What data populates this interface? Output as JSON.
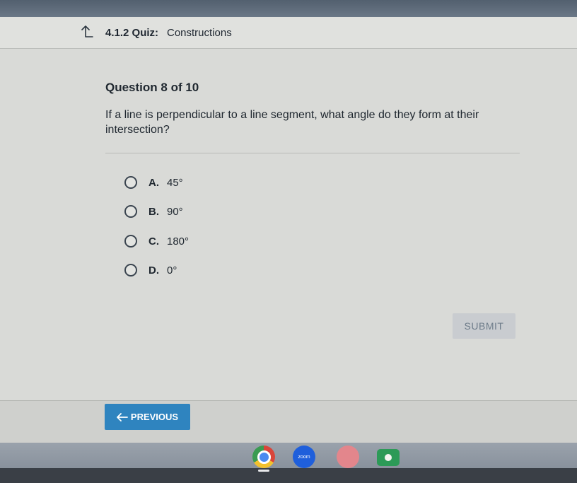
{
  "header": {
    "quiz_code": "4.1.2 Quiz:",
    "quiz_title": "Constructions"
  },
  "question": {
    "number_label": "Question 8 of 10",
    "text": "If a line is perpendicular to a line segment, what angle do they form at their intersection?"
  },
  "options": [
    {
      "letter": "A.",
      "value": "45°"
    },
    {
      "letter": "B.",
      "value": "90°"
    },
    {
      "letter": "C.",
      "value": "180°"
    },
    {
      "letter": "D.",
      "value": "0°"
    }
  ],
  "actions": {
    "submit_label": "SUBMIT",
    "previous_label": "PREVIOUS"
  },
  "taskbar": {
    "zoom_label": "zoom"
  },
  "colors": {
    "primary_button": "#2f84bf",
    "submit_disabled": "#c9ccd0"
  }
}
